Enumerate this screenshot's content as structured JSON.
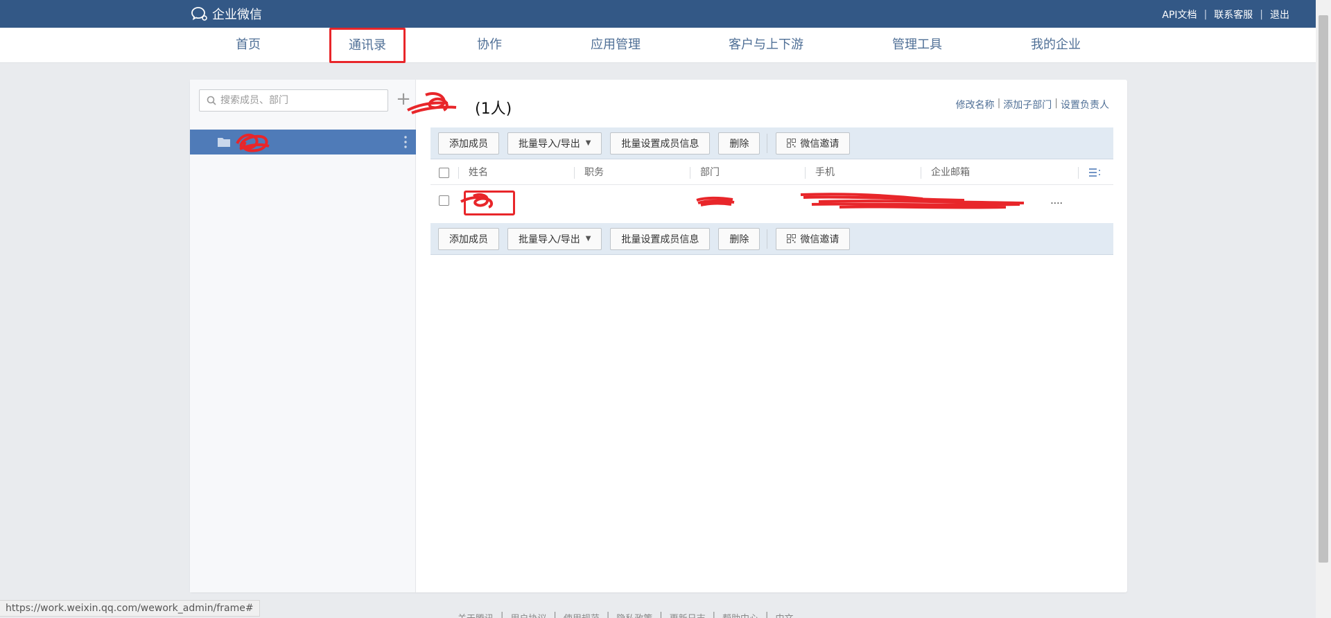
{
  "app": {
    "brand": "企业微信"
  },
  "top_links": [
    "API文档",
    "联系客服",
    "退出"
  ],
  "nav": {
    "items": [
      "首页",
      "通讯录",
      "协作",
      "应用管理",
      "客户与上下游",
      "管理工具",
      "我的企业"
    ],
    "active_index": 1
  },
  "sidebar": {
    "search_placeholder": "搜索成员、部门",
    "add_icon": "plus-icon",
    "tree_item": {
      "label": "",
      "icon": "folder-icon"
    }
  },
  "department": {
    "title_suffix": "(1人)",
    "actions": [
      "修改名称",
      "添加子部门",
      "设置负责人"
    ]
  },
  "toolbar": {
    "buttons": [
      "添加成员",
      "批量导入/导出",
      "批量设置成员信息",
      "删除",
      "微信邀请"
    ],
    "dropdown_caret": "▼"
  },
  "table": {
    "columns": [
      "姓名",
      "职务",
      "部门",
      "手机",
      "企业邮箱"
    ],
    "rows": [
      {
        "name": "",
        "title": "",
        "department": "",
        "phone": "",
        "email": "...."
      }
    ]
  },
  "status_bar": {
    "url": "https://work.weixin.qq.com/wework_admin/frame#"
  },
  "footer": {
    "links": [
      "关于腾讯",
      "用户协议",
      "使用规范",
      "隐私政策",
      "更新日志",
      "帮助中心",
      "中文"
    ]
  },
  "colors": {
    "topbar": "#335886",
    "nav_text": "#4f6f96",
    "selected_tree": "#4f7bb8",
    "toolbar_bg": "#e1eaf3",
    "annotation_red": "#e8262a"
  }
}
